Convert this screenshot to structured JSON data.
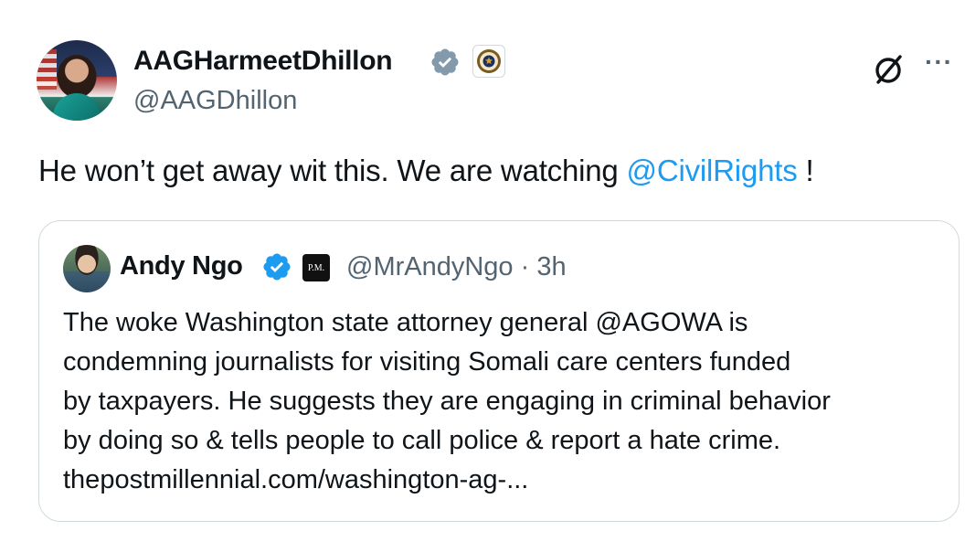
{
  "tweet": {
    "display_name": "AAGHarmeetDhillon",
    "handle": "@AAGDhillon",
    "text_before": "He won’t get away wit this. We are watching ",
    "mention": "@CivilRights",
    "text_after": " !",
    "verified_badge_color": "#829aab",
    "icons": [
      "grok-icon",
      "more-icon"
    ],
    "more_label": "···"
  },
  "quote": {
    "display_name": "Andy Ngo",
    "verified_badge_color": "#1d9bf0",
    "affiliate_badge_text": "P.M.",
    "meta": "@MrAndyNgo · 3h",
    "body_lines": [
      "The woke Washington state attorney general @AGOWA is",
      "condemning journalists for visiting Somali care centers funded",
      "by taxpayers. He suggests they are engaging in criminal behavior",
      "by doing so & tells people to call police & report a hate crime.",
      "thepostmillennial.com/washington-ag-..."
    ]
  },
  "colors": {
    "text": "#0f1419",
    "secondary": "#536471",
    "link": "#1d9bf0",
    "border": "#cfd9de"
  }
}
